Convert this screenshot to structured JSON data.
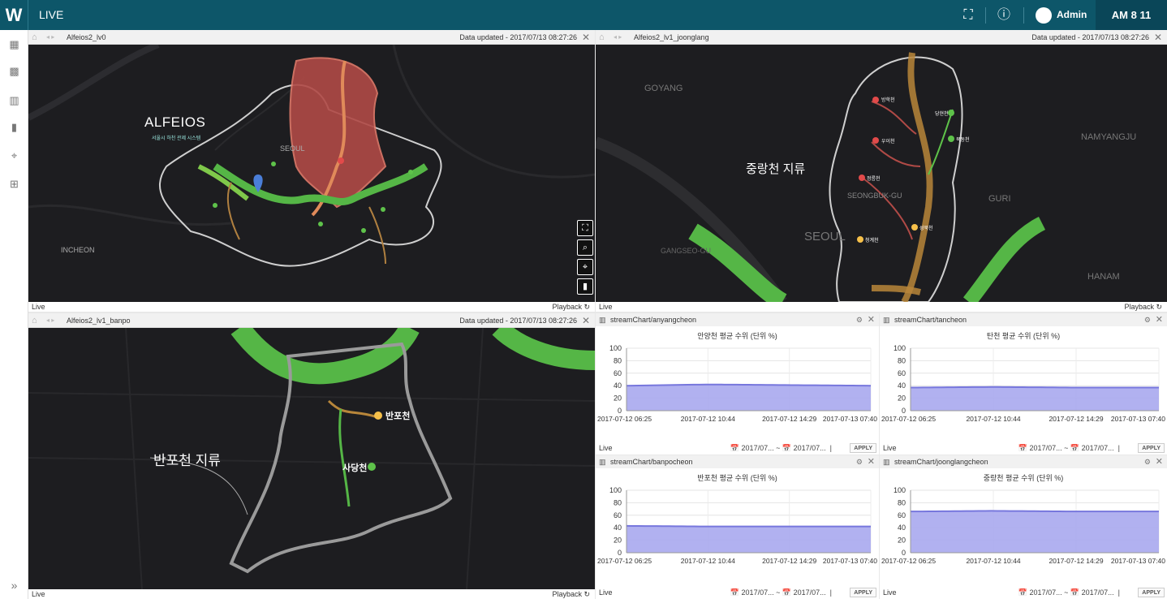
{
  "app": {
    "logo": "W",
    "title": "LIVE",
    "user": "Admin",
    "clock": "AM 8 11"
  },
  "topbar_icons": [
    "fullscreen-icon",
    "info-icon",
    "user-avatar-icon"
  ],
  "sidebar": {
    "items": [
      "map-icon",
      "dashboard-icon",
      "chart-icon",
      "bookmark-icon",
      "location-icon",
      "apps-icon"
    ],
    "expand": "»"
  },
  "panels": [
    {
      "name": "Alfeios2_lv0",
      "updated": "Data updated - 2017/07/13 08:27:26",
      "footer_left": "Live",
      "footer_right": "Playback ↻",
      "labels": {
        "brand": "ALFEIOS",
        "brand_sub": "서울시 하천 관제 시스템",
        "seoul": "SEOUL",
        "incheon": "INCHEON"
      }
    },
    {
      "name": "Alfeios2_lv1_joonglang",
      "updated": "Data updated - 2017/07/13 08:27:26",
      "footer_left": "Live",
      "footer_right": "Playback ↻",
      "labels": {
        "title": "중랑천 지류",
        "seoul": "SEOUL",
        "goyang": "GOYANG",
        "namyangju": "NAMYANGJU",
        "guri": "GURI",
        "hanam": "HANAM",
        "seongbuk": "SEONGBUK-GU",
        "gangseo": "GANGSEO-GU"
      },
      "markers": [
        "방학천",
        "당현천",
        "묵동천",
        "우이천",
        "정릉천",
        "성북천",
        "청계천"
      ]
    },
    {
      "name": "Alfeios2_lv1_banpo",
      "updated": "Data updated - 2017/07/13 08:27:26",
      "footer_left": "Live",
      "footer_right": "Playback ↻",
      "labels": {
        "title": "반포천 지류",
        "banpo": "반포천",
        "sadang": "사당천"
      }
    }
  ],
  "charts": [
    {
      "path": "streamChart/anyangcheon",
      "title": "안양천 평균 수위 (단위 %)",
      "value": 40
    },
    {
      "path": "streamChart/tancheon",
      "title": "탄천 평균 수위 (단위 %)",
      "value": 37
    },
    {
      "path": "streamChart/banpocheon",
      "title": "반포천 평균 수위 (단위 %)",
      "value": 42
    },
    {
      "path": "streamChart/joonglangcheon",
      "title": "중랑천 평균 수위 (단위 %)",
      "value": 66
    }
  ],
  "chart_footer": {
    "live": "Live",
    "date_from": "📅 2017/07...",
    "tilde": "~",
    "date_to": "📅 2017/07...",
    "sep": "|",
    "apply": "APPLY"
  },
  "chart_data": [
    {
      "type": "area",
      "title": "안양천 평균 수위 (단위 %)",
      "x": [
        "2017-07-12 06:25",
        "2017-07-12 10:44",
        "2017-07-12 14:29",
        "2017-07-13 07:40"
      ],
      "values": [
        40,
        42,
        41,
        40
      ],
      "ylim": [
        0,
        100
      ],
      "yticks": [
        0,
        20,
        40,
        60,
        80,
        100
      ]
    },
    {
      "type": "area",
      "title": "탄천 평균 수위 (단위 %)",
      "x": [
        "2017-07-12 06:25",
        "2017-07-12 10:44",
        "2017-07-12 14:29",
        "2017-07-13 07:40"
      ],
      "values": [
        37,
        38,
        37,
        37
      ],
      "ylim": [
        0,
        100
      ],
      "yticks": [
        0,
        20,
        40,
        60,
        80,
        100
      ]
    },
    {
      "type": "area",
      "title": "반포천 평균 수위 (단위 %)",
      "x": [
        "2017-07-12 06:25",
        "2017-07-12 10:44",
        "2017-07-12 14:29",
        "2017-07-13 07:40"
      ],
      "values": [
        43,
        42,
        42,
        42
      ],
      "ylim": [
        0,
        100
      ],
      "yticks": [
        0,
        20,
        40,
        60,
        80,
        100
      ]
    },
    {
      "type": "area",
      "title": "중랑천 평균 수위 (단위 %)",
      "x": [
        "2017-07-12 06:25",
        "2017-07-12 10:44",
        "2017-07-12 14:29",
        "2017-07-13 07:40"
      ],
      "values": [
        66,
        67,
        66,
        66
      ],
      "ylim": [
        0,
        100
      ],
      "yticks": [
        0,
        20,
        40,
        60,
        80,
        100
      ]
    }
  ],
  "colors": {
    "topbar": "#0d5669",
    "chart_fill": "#a9a9ee",
    "chart_line": "#7777dd",
    "river_green": "#5ec24a",
    "district_red": "#c0504d"
  }
}
